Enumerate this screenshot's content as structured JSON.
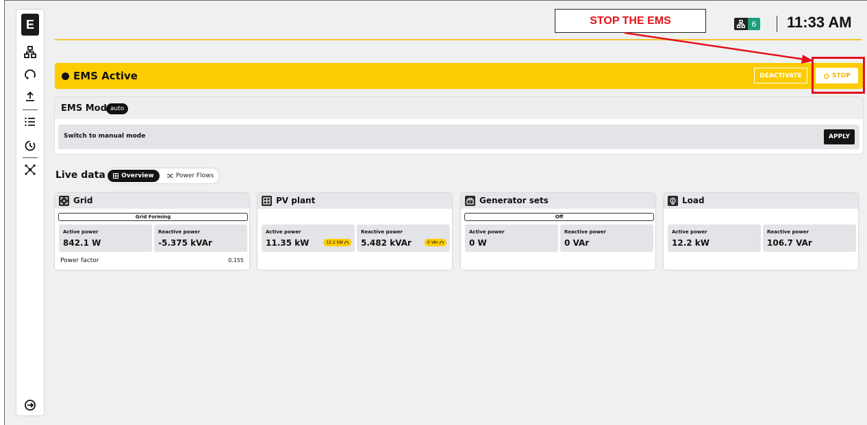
{
  "app": {
    "logo_letter": "E"
  },
  "sidebar": {
    "items": [
      {
        "icon": "topology-icon"
      },
      {
        "icon": "gauge-icon"
      },
      {
        "icon": "upload-icon"
      },
      {
        "icon": "list-icon"
      },
      {
        "icon": "history-icon"
      },
      {
        "icon": "network-icon"
      }
    ],
    "logout_icon": "logout-icon"
  },
  "annotation": {
    "text": "STOP THE EMS",
    "color": "#e3101a"
  },
  "header": {
    "users_count": "6",
    "time": "11:33 AM",
    "accent": "#f2c230"
  },
  "ems_bar": {
    "title": "EMS Active",
    "deactivate_label": "DEACTIVATE",
    "stop_label": "STOP",
    "color": "#fccc00"
  },
  "mode": {
    "title": "EMS Mode",
    "chip": "auto",
    "row_label": "Switch to manual mode",
    "apply_label": "APPLY"
  },
  "live": {
    "title": "Live data",
    "tab_overview": "Overview",
    "tab_power_flows": "Power Flows"
  },
  "cards": {
    "grid": {
      "title": "Grid",
      "status": "Grid Forming",
      "active_label": "Active power",
      "active_value": "842.1 W",
      "reactive_label": "Reactive power",
      "reactive_value": "-5.375 kVAr",
      "pf_label": "Power factor",
      "pf_value": "0.155"
    },
    "pv": {
      "title": "PV plant",
      "active_label": "Active power",
      "active_value": "11.35 kW",
      "active_tag": "12.2 kW",
      "reactive_label": "Reactive power",
      "reactive_value": "5.482 kVAr",
      "reactive_tag": "0 VAr"
    },
    "gen": {
      "title": "Generator sets",
      "status": "Off",
      "active_label": "Active power",
      "active_value": "0 W",
      "reactive_label": "Reactive power",
      "reactive_value": "0 VAr"
    },
    "load": {
      "title": "Load",
      "active_label": "Active power",
      "active_value": "12.2 kW",
      "reactive_label": "Reactive power",
      "reactive_value": "106.7 VAr"
    }
  }
}
